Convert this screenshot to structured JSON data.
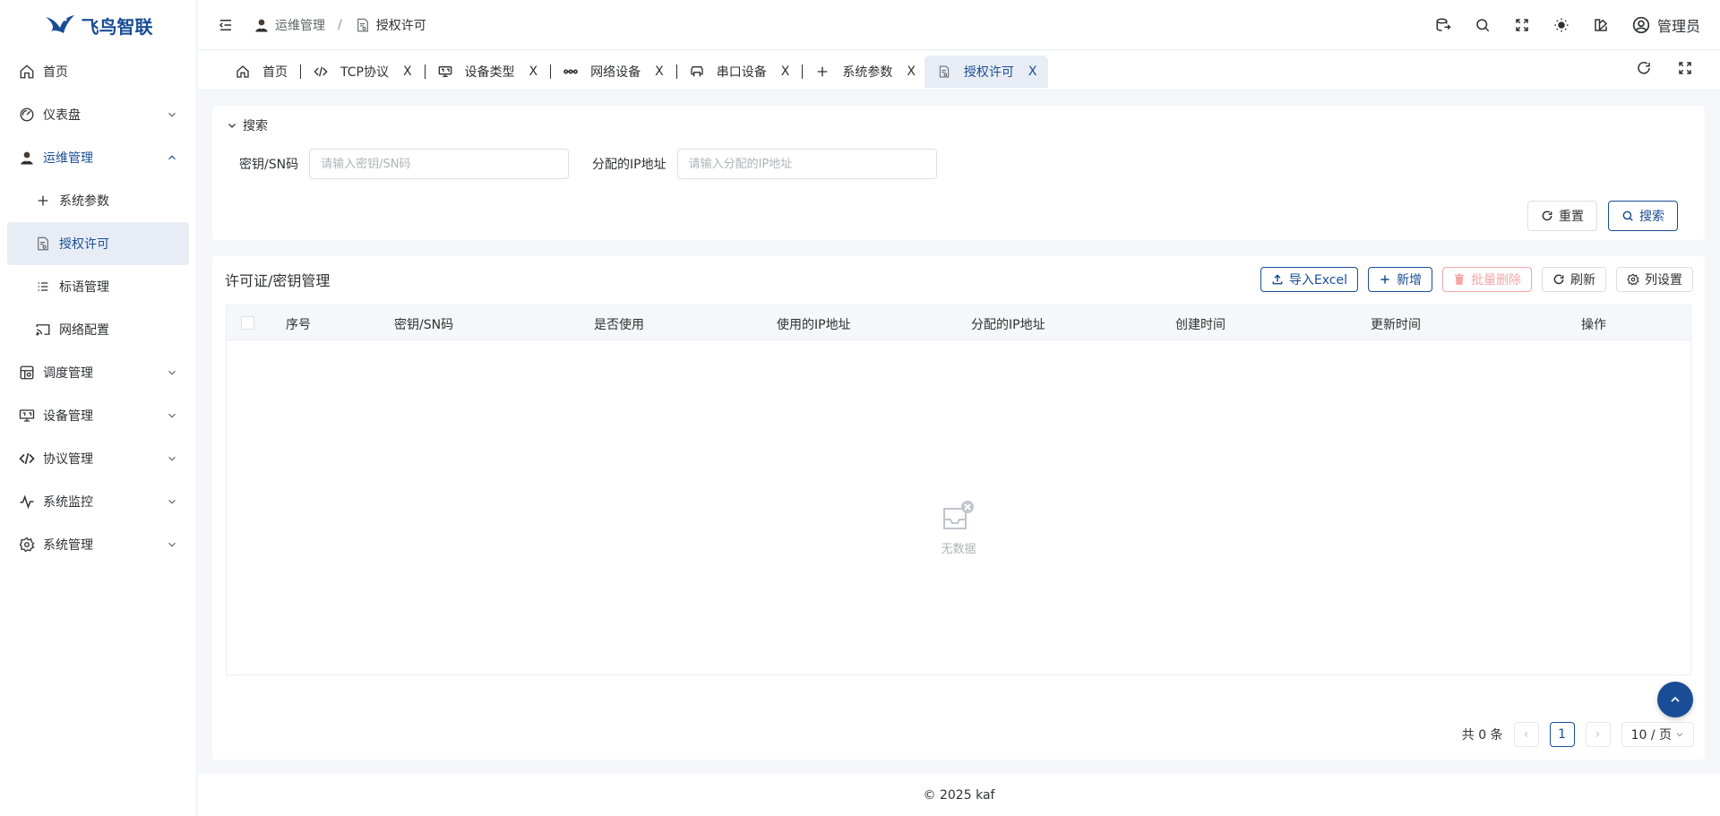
{
  "app": {
    "name": "飞鸟智联",
    "brand_color": "#1a4d96"
  },
  "sidebar": {
    "items": [
      {
        "label": "首页",
        "icon": "home-icon"
      },
      {
        "label": "仪表盘",
        "icon": "dashboard-icon"
      },
      {
        "label": "运维管理",
        "icon": "user-avatar-icon"
      },
      {
        "label": "调度管理",
        "icon": "schedule-icon"
      },
      {
        "label": "设备管理",
        "icon": "monitor-icon"
      },
      {
        "label": "协议管理",
        "icon": "code-icon"
      },
      {
        "label": "系统监控",
        "icon": "pulse-icon"
      },
      {
        "label": "系统管理",
        "icon": "gear-icon"
      }
    ],
    "submenu": [
      {
        "label": "系统参数",
        "icon": "plus-icon"
      },
      {
        "label": "授权许可",
        "icon": "document-icon"
      },
      {
        "label": "标语管理",
        "icon": "list-icon"
      },
      {
        "label": "网络配置",
        "icon": "cast-icon"
      }
    ]
  },
  "header": {
    "breadcrumb": [
      {
        "label": "运维管理"
      },
      {
        "label": "授权许可"
      }
    ],
    "separator": "/",
    "user": "管理员"
  },
  "tabs": [
    {
      "label": "首页"
    },
    {
      "label": "TCP协议",
      "close": "X"
    },
    {
      "label": "设备类型",
      "close": "X"
    },
    {
      "label": "网络设备",
      "close": "X"
    },
    {
      "label": "串口设备",
      "close": "X"
    },
    {
      "label": "系统参数",
      "close": "X"
    },
    {
      "label": "授权许可",
      "close": "X"
    }
  ],
  "search": {
    "toggle_label": "搜索",
    "fields": [
      {
        "label": "密钥/SN码",
        "placeholder": "请输入密钥/SN码",
        "value": ""
      },
      {
        "label": "分配的IP地址",
        "placeholder": "请输入分配的IP地址",
        "value": ""
      }
    ],
    "reset_label": "重置",
    "search_label": "搜索"
  },
  "table": {
    "title": "许可证/密钥管理",
    "actions": {
      "import": "导入Excel",
      "add": "新增",
      "batch_delete": "批量删除",
      "refresh": "刷新",
      "columns": "列设置"
    },
    "columns": [
      "序号",
      "密钥/SN码",
      "是否使用",
      "使用的IP地址",
      "分配的IP地址",
      "创建时间",
      "更新时间",
      "操作"
    ],
    "rows": [],
    "empty_text": "无数据"
  },
  "pagination": {
    "total_text": "共 0 条",
    "prev": "‹",
    "current_page": "1",
    "next": "›",
    "page_size": "10 / 页"
  },
  "footer": {
    "text": "© 2025 kaf"
  }
}
